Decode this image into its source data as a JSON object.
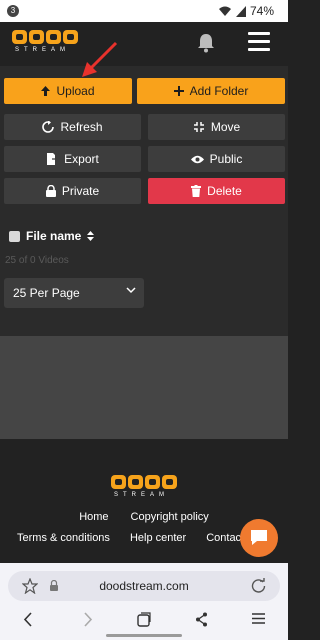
{
  "status_bar": {
    "notification_count": "3",
    "battery": "74%"
  },
  "header": {
    "logo_sub": "STREAM"
  },
  "actions": {
    "upload": "Upload",
    "add_folder": "Add Folder",
    "refresh": "Refresh",
    "move": "Move",
    "export": "Export",
    "public": "Public",
    "private": "Private",
    "delete": "Delete"
  },
  "file_list": {
    "column_header": "File name",
    "count_text": "25 of 0 Videos",
    "per_page_selected": "25 Per Page"
  },
  "footer": {
    "logo_sub": "STREAM",
    "links_row1": [
      "Home",
      "Copyright policy"
    ],
    "links_row2": [
      "Terms & conditions",
      "Help center",
      "Contact"
    ]
  },
  "browser": {
    "url": "doodstream.com"
  },
  "colors": {
    "accent_orange": "#f9a21b",
    "delete_red": "#e2384a",
    "background": "#222222",
    "annotation_arrow": "#e8322c"
  },
  "icons": {
    "upload": "arrow-up-icon",
    "add_folder": "plus-icon",
    "refresh": "refresh-icon",
    "move": "compress-icon",
    "export": "export-icon",
    "public": "eye-icon",
    "private": "lock-icon",
    "delete": "trash-icon"
  }
}
